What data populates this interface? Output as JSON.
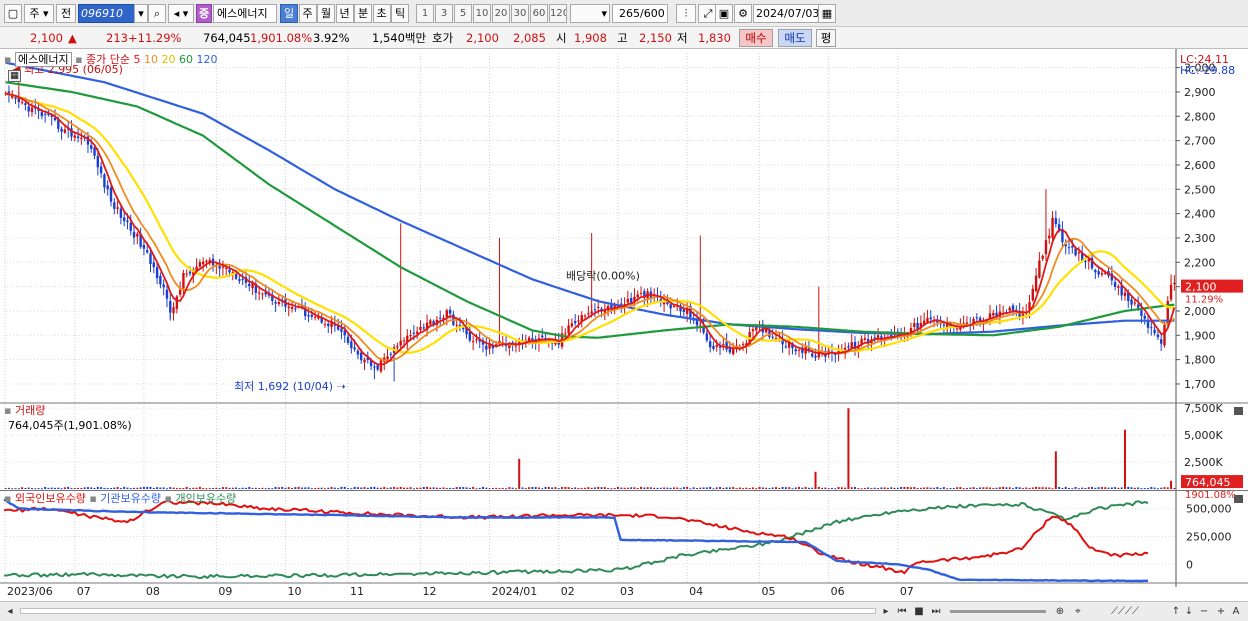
{
  "toolbar": {
    "chart_type": "주",
    "market": "전",
    "code": "096910",
    "badge": "증",
    "name": "에스에너지",
    "periods": [
      "일",
      "주",
      "월",
      "년",
      "분",
      "초",
      "틱"
    ],
    "active_period": "일",
    "intervals": [
      "1",
      "3",
      "5",
      "10",
      "20",
      "30",
      "60",
      "120"
    ],
    "count": "265",
    "count_max": "/600",
    "date": "2024/07/03"
  },
  "quote": {
    "price": "2,100",
    "change": "213",
    "change_pct": "+11.29%",
    "volume": "764,045",
    "volume_pct": "1,901.08%",
    "turnover": "3.92%",
    "amount": "1,540백만",
    "bid_label": "호가",
    "ask": "2,100",
    "bid": "2,085",
    "open_label": "시",
    "open": "1,908",
    "high_label": "고",
    "high": "2,150",
    "low_label": "저",
    "low": "1,830",
    "buy": "매수",
    "sell": "매도",
    "eval": "평"
  },
  "colors": {
    "up": "#d01010",
    "down": "#1a3fd0",
    "ma5": "#e01818",
    "ma10": "#f08c1e",
    "ma20": "#ffe000",
    "ma60": "#1e9a3c",
    "ma120": "#3060e0",
    "foreign": "#e01010",
    "institution": "#3060e0",
    "individual": "#2e8b57"
  },
  "legends": {
    "price_name": "에스에너지",
    "price_ma": "종가 단순",
    "ma_periods": [
      "5",
      "10",
      "20",
      "60",
      "120"
    ],
    "volume_title": "거래량",
    "volume_value": "764,045주(1,901.08%)",
    "holders": [
      "외국인보유수량",
      "기관보유수량",
      "개인보유수량"
    ],
    "lc": "LC:24.11",
    "hc": "HC:-29.88"
  },
  "chart_data": {
    "type": "candlestick",
    "x_labels": [
      "2023/06",
      "07",
      "08",
      "09",
      "10",
      "11",
      "12",
      "2024/01",
      "02",
      "03",
      "04",
      "05",
      "06",
      "07"
    ],
    "price_axis": {
      "ticks": [
        "3,000",
        "2,900",
        "2,800",
        "2,700",
        "2,600",
        "2,500",
        "2,400",
        "2,300",
        "2,200",
        "2,100",
        "2,000",
        "1,900",
        "1,800",
        "1,700"
      ],
      "ylim": [
        1630,
        3060
      ],
      "current_price": "2,100",
      "current_pct": "11.29%"
    },
    "annotations": {
      "high": "최고 2,995 (06/05)",
      "low": "최저 1,692 (10/04)",
      "dividend": "배당락(0.00%)"
    },
    "price_series": {
      "close_anchors": [
        [
          0,
          2880
        ],
        [
          5,
          2850
        ],
        [
          12,
          2800
        ],
        [
          18,
          2740
        ],
        [
          25,
          2700
        ],
        [
          32,
          2450
        ],
        [
          40,
          2300
        ],
        [
          48,
          2100
        ],
        [
          50,
          1980
        ],
        [
          54,
          2140
        ],
        [
          60,
          2200
        ],
        [
          68,
          2170
        ],
        [
          76,
          2090
        ],
        [
          84,
          2030
        ],
        [
          92,
          1990
        ],
        [
          100,
          1940
        ],
        [
          106,
          1830
        ],
        [
          112,
          1760
        ],
        [
          118,
          1840
        ],
        [
          124,
          1920
        ],
        [
          130,
          1960
        ],
        [
          134,
          1990
        ],
        [
          140,
          1900
        ],
        [
          146,
          1850
        ],
        [
          152,
          1870
        ],
        [
          160,
          1880
        ],
        [
          168,
          1870
        ],
        [
          172,
          1960
        ],
        [
          178,
          2000
        ],
        [
          186,
          2020
        ],
        [
          194,
          2070
        ],
        [
          202,
          2020
        ],
        [
          208,
          1990
        ],
        [
          214,
          1860
        ],
        [
          222,
          1840
        ],
        [
          228,
          1930
        ],
        [
          232,
          1910
        ],
        [
          238,
          1860
        ],
        [
          246,
          1820
        ],
        [
          254,
          1840
        ],
        [
          262,
          1880
        ],
        [
          268,
          1900
        ],
        [
          274,
          1920
        ],
        [
          280,
          1960
        ],
        [
          286,
          1940
        ],
        [
          292,
          1950
        ],
        [
          298,
          1970
        ],
        [
          304,
          2000
        ],
        [
          310,
          1980
        ],
        [
          314,
          2200
        ],
        [
          318,
          2370
        ],
        [
          322,
          2260
        ],
        [
          328,
          2210
        ],
        [
          334,
          2140
        ],
        [
          340,
          2060
        ],
        [
          344,
          2010
        ],
        [
          348,
          1920
        ],
        [
          351,
          1880
        ],
        [
          354,
          2100
        ]
      ],
      "ma60_anchors": [
        [
          0,
          2940
        ],
        [
          20,
          2900
        ],
        [
          40,
          2840
        ],
        [
          60,
          2720
        ],
        [
          80,
          2520
        ],
        [
          100,
          2350
        ],
        [
          120,
          2180
        ],
        [
          140,
          2040
        ],
        [
          160,
          1920
        ],
        [
          170,
          1895
        ],
        [
          180,
          1890
        ],
        [
          200,
          1920
        ],
        [
          220,
          1945
        ],
        [
          240,
          1935
        ],
        [
          260,
          1915
        ],
        [
          280,
          1905
        ],
        [
          300,
          1900
        ],
        [
          320,
          1935
        ],
        [
          340,
          2000
        ],
        [
          354,
          2025
        ]
      ],
      "ma120_anchors": [
        [
          0,
          3020
        ],
        [
          30,
          2940
        ],
        [
          60,
          2810
        ],
        [
          80,
          2660
        ],
        [
          100,
          2500
        ],
        [
          120,
          2370
        ],
        [
          140,
          2250
        ],
        [
          160,
          2130
        ],
        [
          180,
          2040
        ],
        [
          200,
          1985
        ],
        [
          220,
          1945
        ],
        [
          240,
          1925
        ],
        [
          260,
          1910
        ],
        [
          280,
          1905
        ],
        [
          300,
          1915
        ],
        [
          320,
          1940
        ],
        [
          340,
          1960
        ],
        [
          354,
          1960
        ]
      ]
    },
    "volume_axis": {
      "ticks": [
        "7,500K",
        "5,000K",
        "2,500K",
        "0"
      ],
      "ylim": [
        0,
        7800
      ],
      "current": "764,045",
      "current_pct": "1901.08%",
      "spikes_k": [
        [
          156,
          2800
        ],
        [
          246,
          1600
        ],
        [
          256,
          7500
        ],
        [
          319,
          3500
        ],
        [
          340,
          5500
        ],
        [
          354,
          764
        ]
      ]
    },
    "holders_axis": {
      "ticks": [
        "500,000",
        "250,000",
        "0"
      ],
      "ylim": [
        -150000,
        640000
      ],
      "foreign": [
        [
          0,
          480000
        ],
        [
          15,
          500000
        ],
        [
          30,
          420000
        ],
        [
          40,
          380000
        ],
        [
          52,
          560000
        ],
        [
          70,
          545000
        ],
        [
          85,
          500000
        ],
        [
          100,
          480000
        ],
        [
          120,
          450000
        ],
        [
          140,
          430000
        ],
        [
          155,
          420000
        ],
        [
          175,
          440000
        ],
        [
          200,
          440000
        ],
        [
          215,
          430000
        ],
        [
          240,
          300000
        ],
        [
          255,
          240000
        ],
        [
          265,
          100000
        ],
        [
          275,
          20000
        ],
        [
          285,
          -30000
        ],
        [
          292,
          -80000
        ],
        [
          296,
          20000
        ],
        [
          310,
          50000
        ],
        [
          320,
          80000
        ],
        [
          330,
          140000
        ],
        [
          340,
          440000
        ],
        [
          346,
          360000
        ],
        [
          352,
          150000
        ],
        [
          360,
          80000
        ],
        [
          370,
          90000
        ]
      ],
      "institution": [
        [
          0,
          580000
        ],
        [
          5,
          500000
        ],
        [
          40,
          470000
        ],
        [
          100,
          445000
        ],
        [
          150,
          420000
        ],
        [
          198,
          420000
        ],
        [
          200,
          220000
        ],
        [
          260,
          200000
        ],
        [
          270,
          30000
        ],
        [
          290,
          0
        ],
        [
          300,
          -50000
        ],
        [
          310,
          -140000
        ],
        [
          370,
          -150000
        ]
      ],
      "individual": [
        [
          0,
          -100000
        ],
        [
          30,
          -90000
        ],
        [
          60,
          -110000
        ],
        [
          100,
          -100000
        ],
        [
          150,
          -80000
        ],
        [
          200,
          -50000
        ],
        [
          220,
          80000
        ],
        [
          250,
          200000
        ],
        [
          270,
          380000
        ],
        [
          290,
          480000
        ],
        [
          310,
          520000
        ],
        [
          330,
          540000
        ],
        [
          345,
          400000
        ],
        [
          355,
          500000
        ],
        [
          370,
          560000
        ]
      ]
    }
  }
}
